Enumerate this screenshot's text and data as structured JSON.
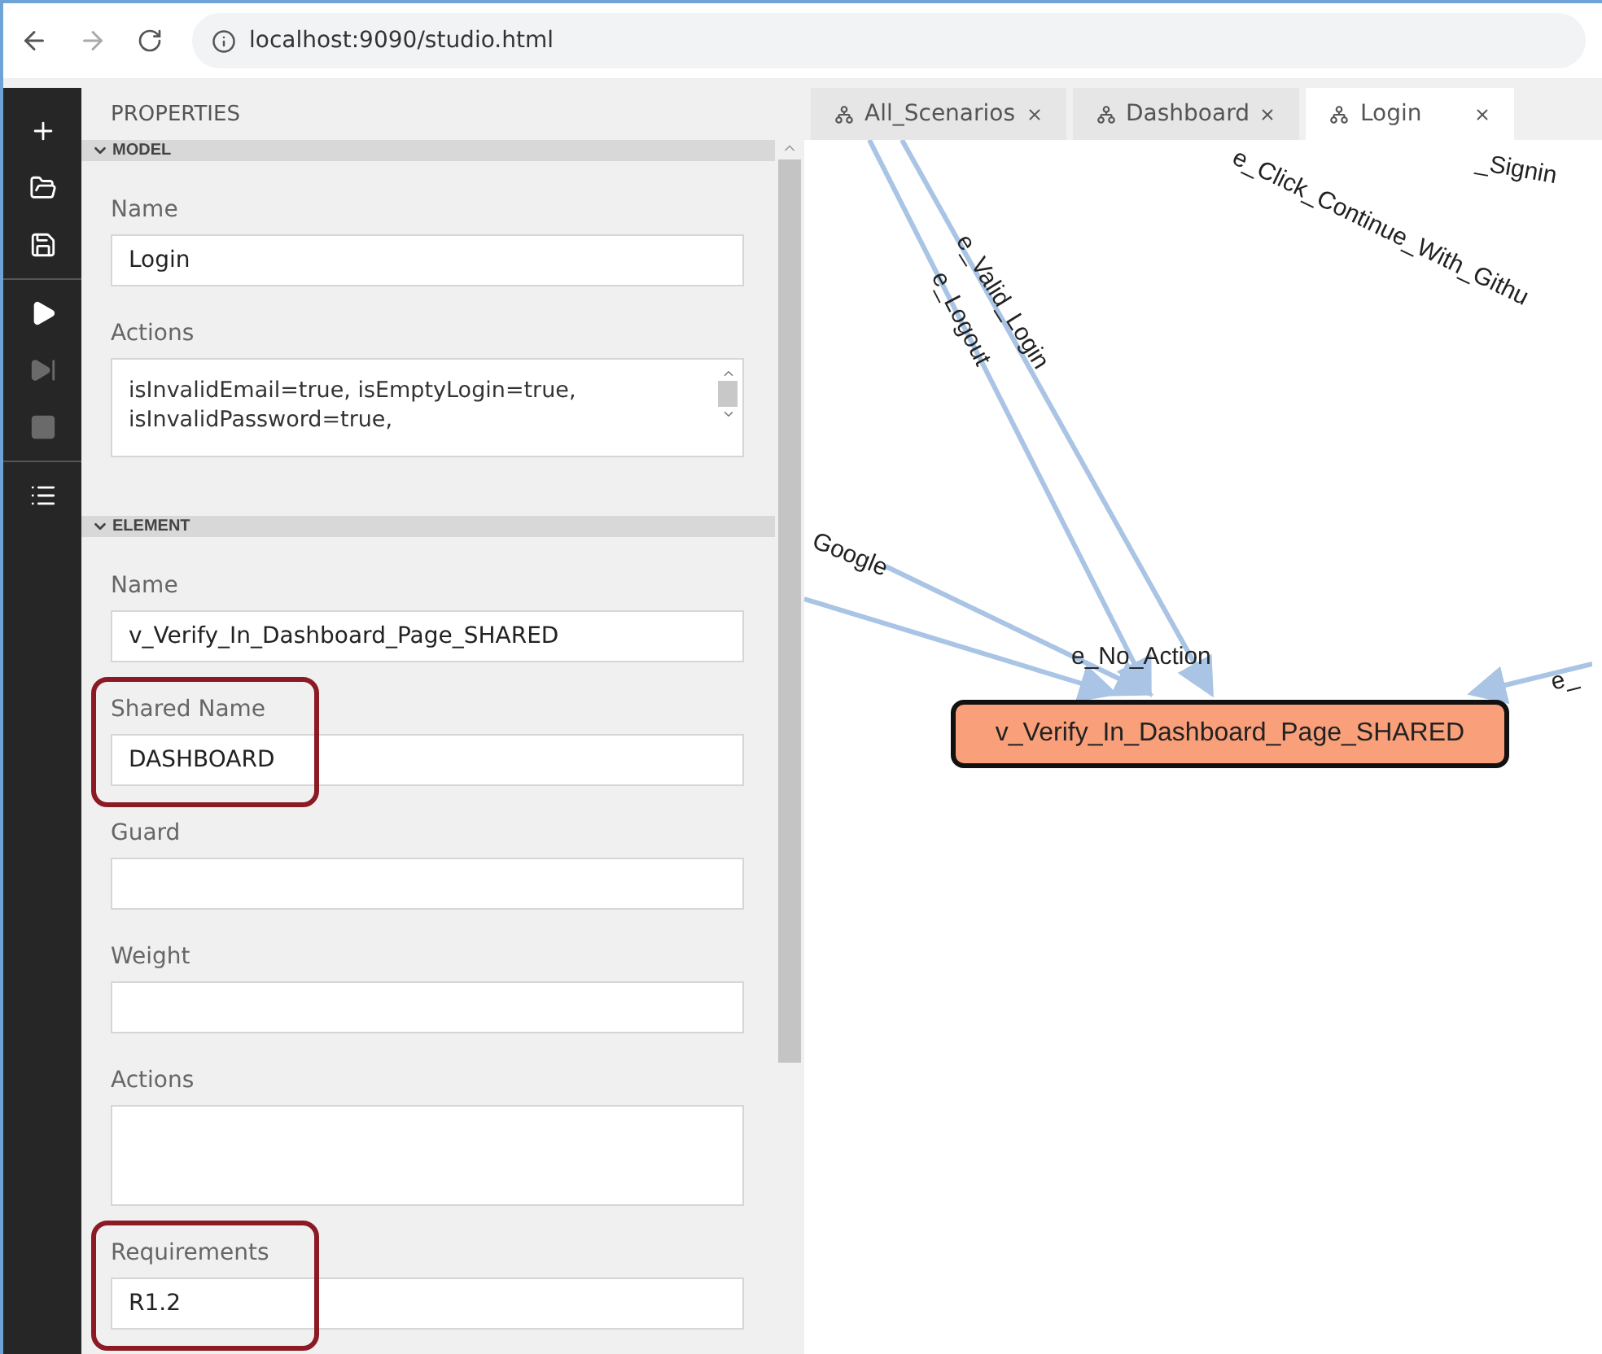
{
  "browser": {
    "url": "localhost:9090/studio.html"
  },
  "toolbar": [
    [
      {
        "kind": "add",
        "disabled": false
      },
      {
        "kind": "open",
        "disabled": false
      },
      {
        "kind": "save",
        "disabled": false
      }
    ],
    [
      {
        "kind": "run",
        "disabled": false
      },
      {
        "kind": "step",
        "disabled": true
      },
      {
        "kind": "stop",
        "disabled": true
      }
    ],
    [
      {
        "kind": "list",
        "disabled": false
      }
    ]
  ],
  "properties": {
    "title": "PROPERTIES",
    "sections": [
      {
        "title": "MODEL",
        "expanded": true,
        "fields": [
          {
            "label": "Name",
            "kind": "input",
            "value": "Login",
            "highlighted": false
          },
          {
            "label": "Actions",
            "kind": "textarea",
            "value": "isInvalidEmail=true, isEmptyLogin=true, isInvalidPassword=true,",
            "highlighted": false
          }
        ]
      },
      {
        "title": "ELEMENT",
        "expanded": true,
        "fields": [
          {
            "label": "Name",
            "kind": "input",
            "value": "v_Verify_In_Dashboard_Page_SHARED",
            "highlighted": false
          },
          {
            "label": "Shared Name",
            "kind": "input",
            "value": "DASHBOARD",
            "highlighted": true
          },
          {
            "label": "Guard",
            "kind": "input",
            "highlighted": false
          },
          {
            "label": "Weight",
            "kind": "input",
            "highlighted": false
          },
          {
            "label": "Actions",
            "kind": "textarea",
            "highlighted": false
          },
          {
            "label": "Requirements",
            "kind": "input",
            "value": "R1.2",
            "highlighted": true
          }
        ]
      }
    ]
  },
  "tabs": [
    {
      "label": "All_Scenarios",
      "selected": false
    },
    {
      "label": "Dashboard",
      "selected": false
    },
    {
      "label": "Login",
      "selected": true
    }
  ],
  "graph": {
    "edges": [
      {
        "label": "e_Logout"
      },
      {
        "label": "e_Valid_Login"
      },
      {
        "label": "Google"
      },
      {
        "label": "e_No_Action"
      },
      {
        "label": "e_"
      },
      {
        "label": "e_Click_Continue_With_Githu"
      },
      {
        "label": "_Signin"
      }
    ],
    "node": {
      "label": "v_Verify_In_Dashboard_Page_SHARED",
      "selected": true
    }
  }
}
